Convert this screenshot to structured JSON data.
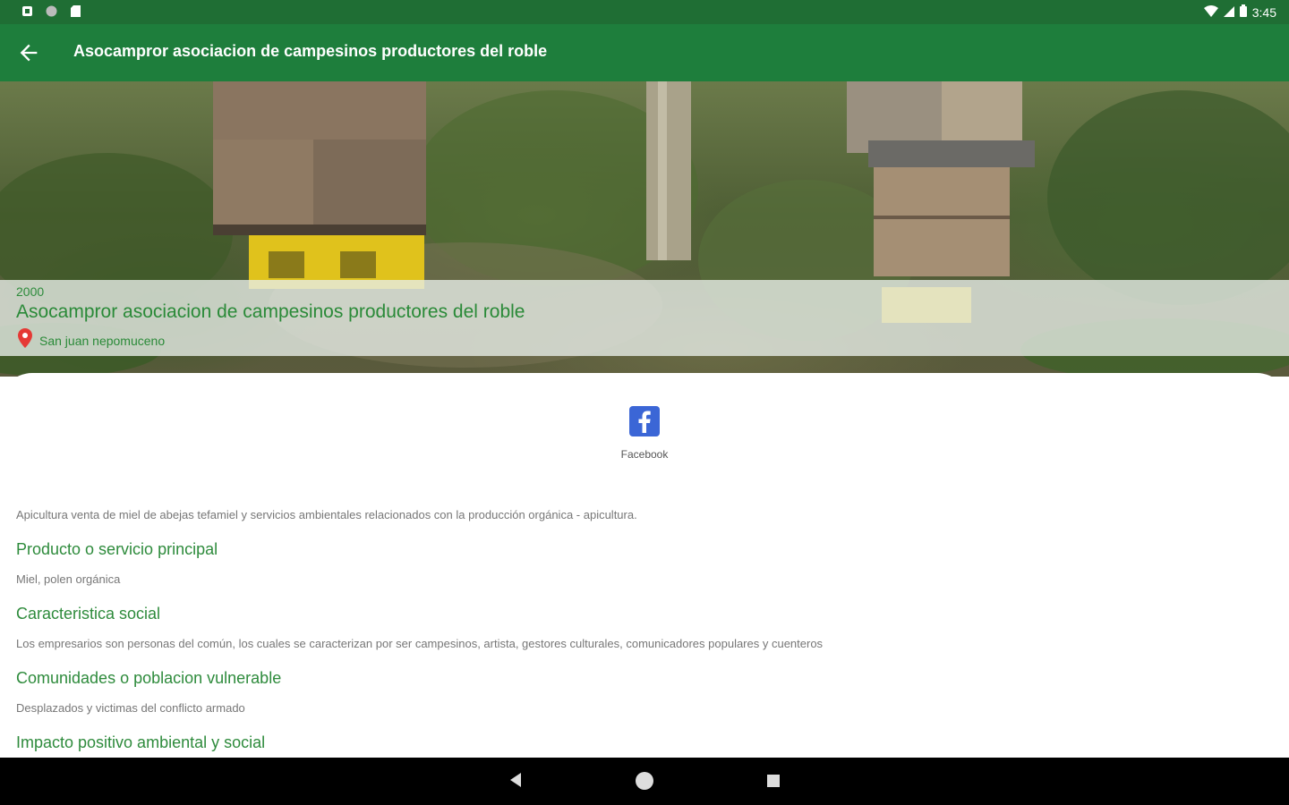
{
  "status_bar": {
    "time": "3:45"
  },
  "app_bar": {
    "title": "Asocampror asociacion de campesinos productores del roble"
  },
  "hero": {
    "year": "2000",
    "name": "Asocampror asociacion de campesinos productores del roble",
    "location": "San juan nepomuceno"
  },
  "social": {
    "facebook_label": "Facebook"
  },
  "description": "Apicultura venta de miel de abejas tefamiel y servicios ambientales relacionados con la producción orgánica - apicultura.",
  "sections": [
    {
      "heading": "Producto o servicio principal",
      "text": "Miel, polen orgánica"
    },
    {
      "heading": "Caracteristica social",
      "text": "Los empresarios son personas del común, los cuales se caracterizan por ser campesinos, artista, gestores culturales, comunicadores populares y cuenteros"
    },
    {
      "heading": "Comunidades o poblacion vulnerable",
      "text": "Desplazados y victimas del conflicto armado"
    },
    {
      "heading": "Impacto positivo ambiental y social",
      "text": ""
    }
  ],
  "colors": {
    "primary": "#1e7e3c",
    "status_bar": "#1f6e34",
    "accent_text": "#2e8b3c",
    "facebook": "#3b66d6",
    "location_pin": "#e53935"
  }
}
